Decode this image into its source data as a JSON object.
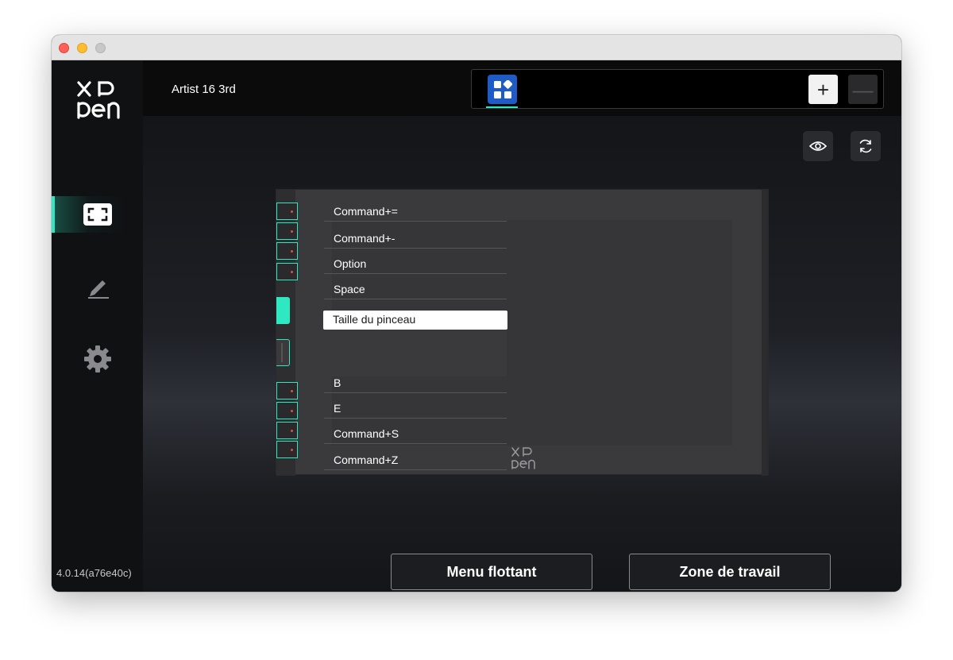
{
  "sidebar": {
    "logo": "XP-Pen logo",
    "items": [
      {
        "icon": "screen-icon",
        "active": true
      },
      {
        "icon": "pen-icon",
        "active": false
      },
      {
        "icon": "gear-icon",
        "active": false
      }
    ],
    "version": "4.0.14(a76e40c)"
  },
  "topbar": {
    "device_name": "Artist 16 3rd",
    "app_icon": "all-apps-icon",
    "add_icon": "+",
    "remove_icon": "—"
  },
  "tools": {
    "preview_icon": "eye-icon",
    "reset_icon": "refresh-icon"
  },
  "tablet": {
    "keys_top": [
      "Command+=",
      "Command+-",
      "Option",
      "Space"
    ],
    "dial": "Taille du pinceau",
    "keys_bottom": [
      "B",
      "E",
      "Command+S",
      "Command+Z"
    ]
  },
  "buttons": {
    "floating_menu": "Menu flottant",
    "work_area": "Zone de travail"
  },
  "colors": {
    "accent": "#2ee8c2",
    "app_tile": "#1e5bc4",
    "background": "#141518"
  }
}
